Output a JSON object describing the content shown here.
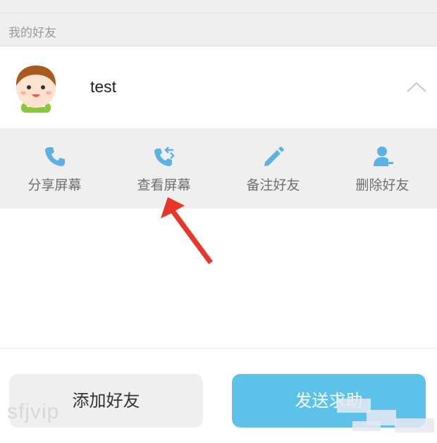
{
  "section": {
    "title": "我的好友"
  },
  "friend": {
    "name": "test"
  },
  "actions": [
    {
      "label": "分享屏幕",
      "icon": "phone-icon"
    },
    {
      "label": "查看屏幕",
      "icon": "phone-callback-icon"
    },
    {
      "label": "备注好友",
      "icon": "pencil-icon"
    },
    {
      "label": "删除好友",
      "icon": "remove-user-icon"
    }
  ],
  "buttons": {
    "add_friend": "添加好友",
    "send_help": "发送求助"
  },
  "watermark": "sfjvip",
  "colors": {
    "accent": "#5cc2ea",
    "action_bar_bg": "#efefef",
    "arrow": "#e8362a"
  }
}
